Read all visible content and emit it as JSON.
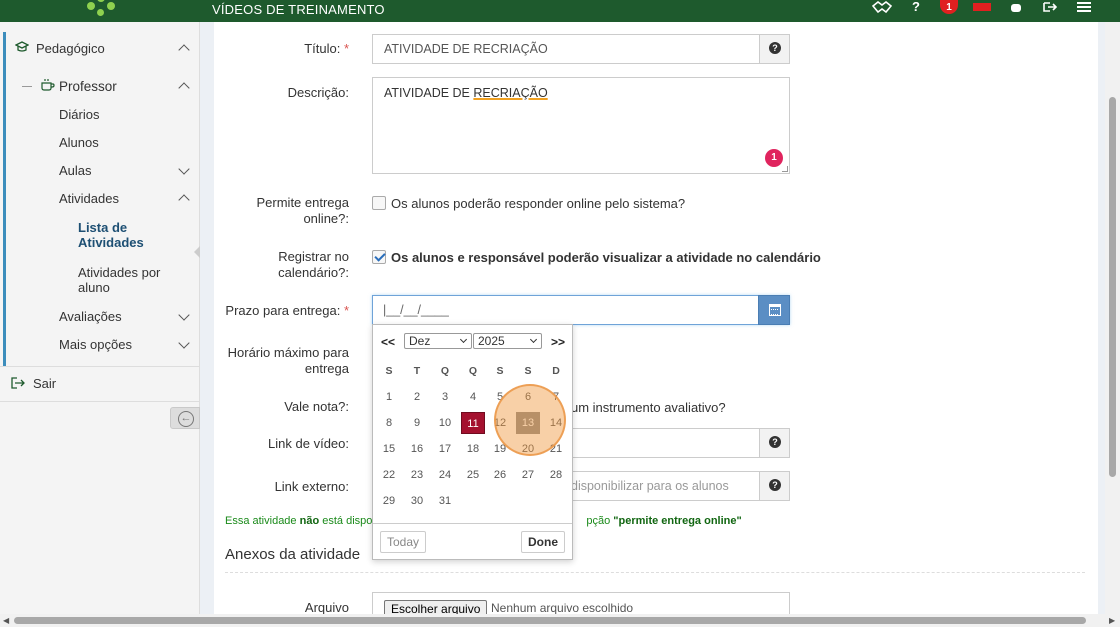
{
  "topbar": {
    "title": "VÍDEOS DE TREINAMENTO",
    "notification_count": "1",
    "icons": [
      "handshake-icon",
      "question-icon",
      "notification-badge",
      "mail-icon",
      "user-icon",
      "logout-icon",
      "menu-icon"
    ]
  },
  "sidebar": {
    "section": "Pedagógico",
    "professor": "Professor",
    "items": [
      "Diários",
      "Alunos",
      "Aulas",
      "Atividades"
    ],
    "sub_items": [
      "Lista de Atividades",
      "Atividades por aluno"
    ],
    "after_items": [
      "Avaliações",
      "Mais opções"
    ],
    "logout": "Sair"
  },
  "form": {
    "titulo_label": "Título:",
    "required_mark": "*",
    "titulo_value": "ATIVIDADE DE RECRIAÇÃO",
    "descricao_label": "Descrição:",
    "descricao_value_prefix": "ATIVIDADE DE ",
    "descricao_value_word": "RECRIAÇÃO",
    "error_count": "1",
    "entrega_label": "Permite entrega online?:",
    "entrega_text": "Os alunos poderão responder online pelo sistema?",
    "calendario_label": "Registrar no calendário?:",
    "calendario_text": "Os alunos e responsável poderão visualizar a atividade no calendário",
    "prazo_label": "Prazo para entrega:",
    "prazo_value": "|__/__/____",
    "horario_label": "Horário máximo para entrega",
    "vale_nota_label": "Vale nota?:",
    "vale_nota_text": "um instrumento avaliativo?",
    "video_label": "Link de vídeo:",
    "externo_label": "Link externo:",
    "externo_placeholder": "disponibilizar para os alunos",
    "note_prefix": "Essa atividade ",
    "note_bold": "não",
    "note_mid": " está dispo",
    "note_tail": "pção ",
    "note_quote": "\"permite entrega online\"",
    "anexos_title": "Anexos da atividade",
    "arquivo_label": "Arquivo",
    "file_button": "Escolher arquivo",
    "file_text": "Nenhum arquivo escolhido"
  },
  "datepicker": {
    "prev": "<<",
    "next": ">>",
    "month": "Dez",
    "year": "2025",
    "weekdays": [
      "S",
      "T",
      "Q",
      "Q",
      "S",
      "S",
      "D"
    ],
    "weeks": [
      [
        "1",
        "2",
        "3",
        "4",
        "5",
        "6",
        "7"
      ],
      [
        "8",
        "9",
        "10",
        "11",
        "12",
        "13",
        "14"
      ],
      [
        "15",
        "16",
        "17",
        "18",
        "19",
        "20",
        "21"
      ],
      [
        "22",
        "23",
        "24",
        "25",
        "26",
        "27",
        "28"
      ],
      [
        "29",
        "30",
        "31",
        "",
        "",
        "",
        ""
      ]
    ],
    "selected_day": "11",
    "hover_day": "13",
    "today_label": "Today",
    "done_label": "Done"
  },
  "colors": {
    "topbar": "#1e5a2d",
    "selected_day": "#a4112f",
    "accent": "#3c8dbc",
    "note_text": "#1a8a1a"
  }
}
